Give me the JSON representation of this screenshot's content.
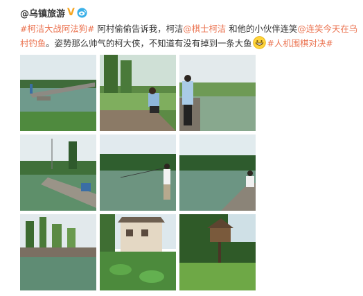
{
  "post": {
    "author": "@乌镇旅游",
    "verified_mark": "V",
    "text": {
      "topic1": "#柯洁大战阿法狗#",
      "seg1": " 阿村偷偷告诉我，柯洁",
      "mention1": "@棋士柯洁",
      "seg2": " 和他的小伙伴连笑",
      "mention2": "@连笑今天在乌村钓鱼",
      "seg3": "。姿势那么帅气的柯大侠，不知道有没有掉到一条大鱼",
      "topic2": "#人机围棋对决#"
    },
    "emoji_icon": "grin-emoji-icon",
    "colors": {
      "link": "#eb7350",
      "verified": "#f5a623",
      "weibo_blue": "#3ab0e8"
    }
  },
  "photos": [
    {
      "name": "photo-1",
      "scene": "fishing-pier-lake"
    },
    {
      "name": "photo-2",
      "scene": "man-fishing-seated"
    },
    {
      "name": "photo-3",
      "scene": "man-standing-fishing"
    },
    {
      "name": "photo-4",
      "scene": "lake-with-pylon"
    },
    {
      "name": "photo-5",
      "scene": "man-casting-rod"
    },
    {
      "name": "photo-6",
      "scene": "man-seated-on-dock"
    },
    {
      "name": "photo-7",
      "scene": "canal-with-trees"
    },
    {
      "name": "photo-8",
      "scene": "village-house-lotus"
    },
    {
      "name": "photo-9",
      "scene": "treehouse-lawn"
    }
  ]
}
